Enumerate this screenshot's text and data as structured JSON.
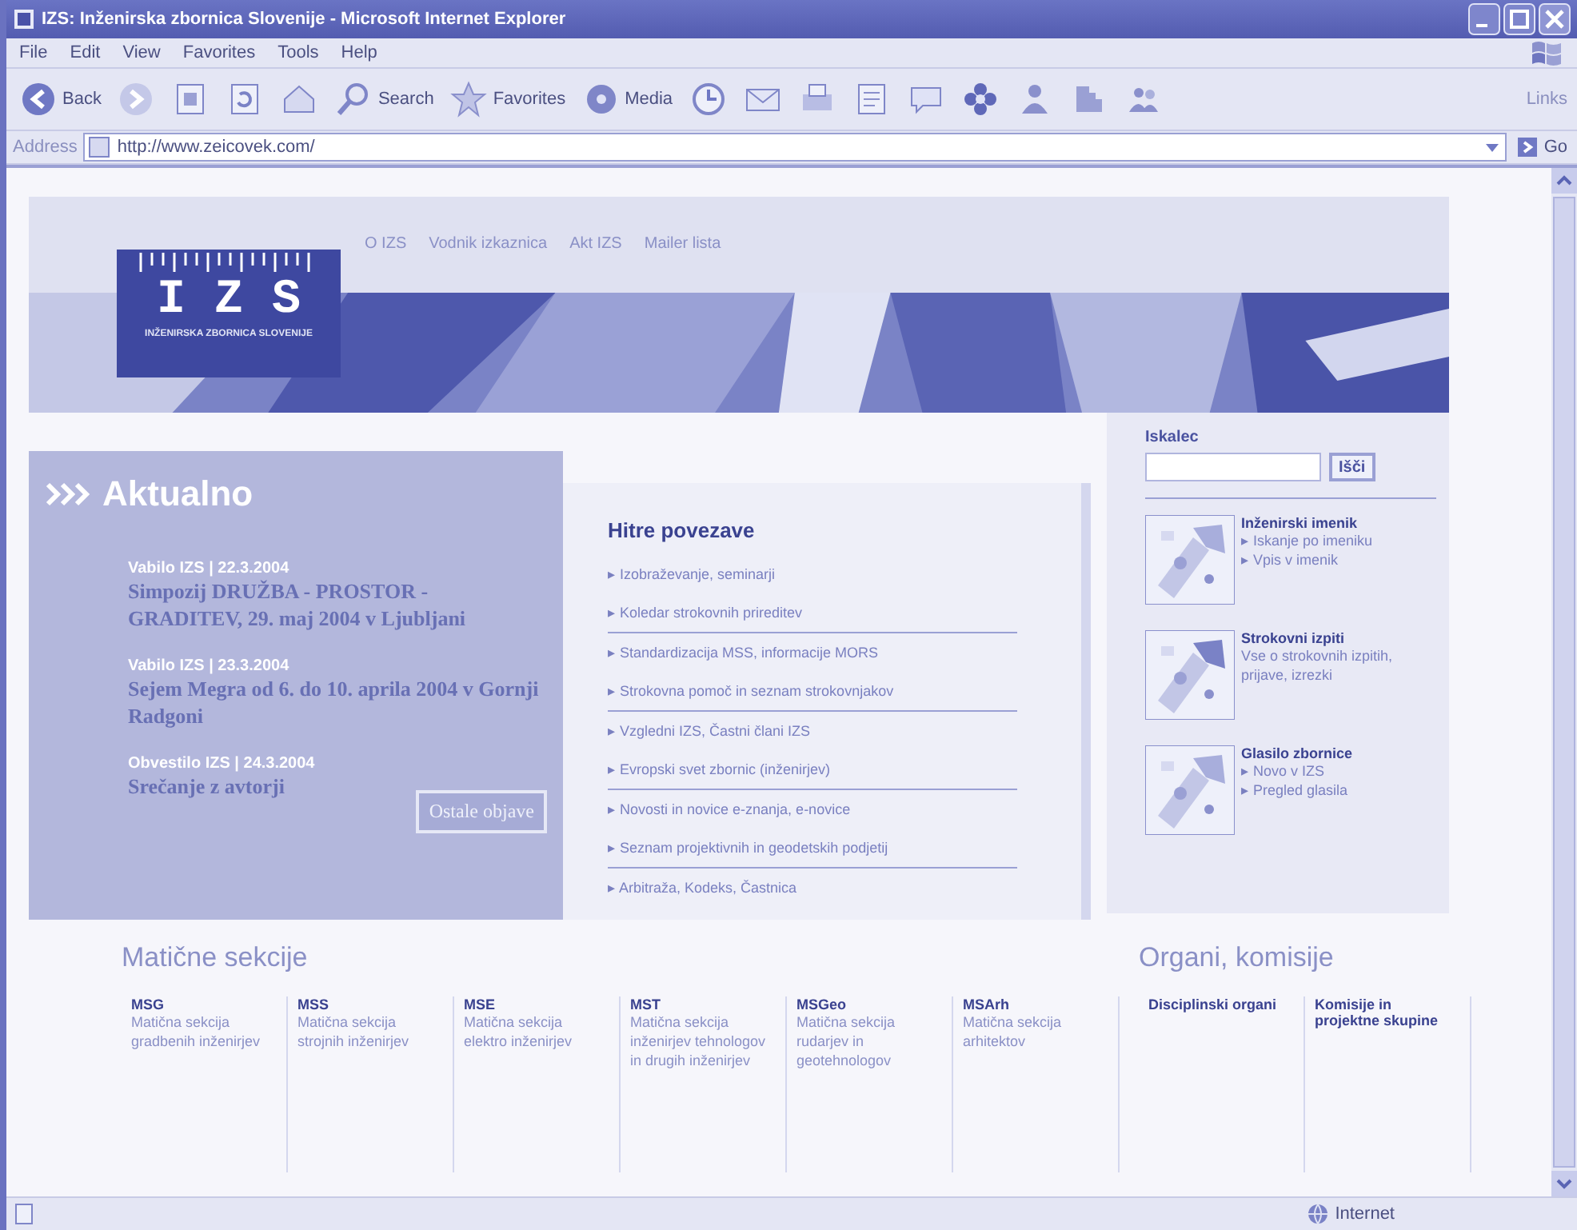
{
  "window": {
    "title": "IZS: Inženirska zbornica Slovenije - Microsoft Internet Explorer"
  },
  "menu": [
    "File",
    "Edit",
    "View",
    "Favorites",
    "Tools",
    "Help"
  ],
  "toolbar": [
    {
      "kind": "back",
      "label": "Back"
    },
    {
      "kind": "forward"
    },
    {
      "kind": "stop"
    },
    {
      "kind": "refresh"
    },
    {
      "kind": "home"
    },
    {
      "kind": "search",
      "label": "Search"
    },
    {
      "kind": "favorites",
      "label": "Favorites"
    },
    {
      "kind": "media",
      "label": "Media"
    },
    {
      "kind": "history"
    },
    {
      "kind": "mail"
    },
    {
      "kind": "print"
    },
    {
      "kind": "edit"
    },
    {
      "kind": "discuss"
    },
    {
      "kind": "flower"
    },
    {
      "kind": "messenger"
    },
    {
      "kind": "tool"
    },
    {
      "kind": "people"
    }
  ],
  "links_label": "Links",
  "address": {
    "label": "Address",
    "url": "http://www.zeicovek.com/",
    "go": "Go"
  },
  "site": {
    "logo": {
      "text": "I Z S",
      "subtitle": "INŽENIRSKA ZBORNICA SLOVENIJE"
    },
    "nav": [
      "O IZS",
      "Vodnik izkaznica",
      "Akt IZS",
      "Mailer lista"
    ],
    "aktualno": {
      "heading": "Aktualno",
      "items": [
        {
          "meta": "Vabilo IZS | 22.3.2004",
          "title": "Simpozij DRUŽBA - PROSTOR - GRADITEV, 29. maj 2004 v Ljubljani"
        },
        {
          "meta": "Vabilo IZS | 23.3.2004",
          "title": "Sejem Megra od 6. do 10. aprila 2004 v Gornji Radgoni"
        },
        {
          "meta": "Obvestilo IZS | 24.3.2004",
          "title": "Srečanje z avtorji"
        }
      ],
      "more": "Ostale objave"
    },
    "quick_links": {
      "heading": "Hitre povezave",
      "groups": [
        [
          "▸ Izobraževanje, seminarji",
          "▸ Koledar strokovnih prireditev"
        ],
        [
          "▸ Standardizacija MSS, informacije MORS",
          "▸ Strokovna pomoč in seznam strokovnjakov"
        ],
        [
          "▸ Vzgledni IZS, Častni člani IZS",
          "▸ Evropski svet zbornic (inženirjev)"
        ],
        [
          "▸ Novosti in novice e-znanja, e-novice",
          "▸ Seznam projektivnih in geodetskih podjetij"
        ],
        [
          "▸ Arbitraža, Kodeks, Častnica"
        ]
      ]
    },
    "search": {
      "label": "Iskalec",
      "button": "Išči"
    },
    "features": [
      {
        "title": "Inženirski imenik",
        "lines": [
          "▸ Iskanje po imeniku",
          "▸ Vpis v imenik"
        ]
      },
      {
        "title": "Strokovni izpiti",
        "lines": [
          "Vse o strokovnih izpitih, prijave, izrezki"
        ]
      },
      {
        "title": "Glasilo zbornice",
        "lines": [
          "▸ Novo v IZS",
          "▸ Pregled glasila"
        ]
      }
    ],
    "sections": {
      "heading": "Matične sekcije",
      "items": [
        {
          "code": "MSG",
          "text": "Matična sekcija gradbenih inženirjev"
        },
        {
          "code": "MSS",
          "text": "Matična sekcija strojnih inženirjev"
        },
        {
          "code": "MSE",
          "text": "Matična sekcija elektro inženirjev"
        },
        {
          "code": "MST",
          "text": "Matična sekcija inženirjev tehnologov in drugih inženirjev"
        },
        {
          "code": "MSGeo",
          "text": "Matična sekcija rudarjev in geotehnologov"
        },
        {
          "code": "MSArh",
          "text": "Matična sekcija arhitektov"
        }
      ]
    },
    "organs": {
      "heading": "Organi, komisije",
      "items": [
        "Disciplinski organi",
        "Komisije in projektne skupine"
      ]
    }
  },
  "status_bar": {
    "zone": "Internet"
  }
}
